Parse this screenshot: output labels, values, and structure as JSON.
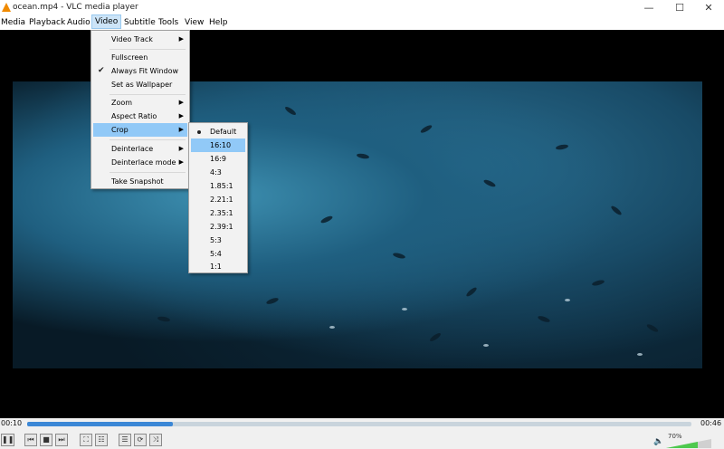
{
  "window": {
    "title": "ocean.mp4 - VLC media player"
  },
  "window_controls": {
    "minimize": "—",
    "maximize": "☐",
    "close": "✕"
  },
  "menubar": {
    "items": [
      "Media",
      "Playback",
      "Audio",
      "Video",
      "Subtitle",
      "Tools",
      "View",
      "Help"
    ],
    "open": "Video"
  },
  "video_menu": {
    "items": [
      {
        "label": "Video Track",
        "submenu": true
      },
      {
        "label": "Fullscreen"
      },
      {
        "label": "Always Fit Window",
        "checked": true
      },
      {
        "label": "Set as Wallpaper"
      },
      {
        "label": "Zoom",
        "submenu": true
      },
      {
        "label": "Aspect Ratio",
        "submenu": true
      },
      {
        "label": "Crop",
        "submenu": true,
        "highlighted": true
      },
      {
        "label": "Deinterlace",
        "submenu": true
      },
      {
        "label": "Deinterlace mode",
        "submenu": true
      },
      {
        "label": "Take Snapshot"
      }
    ]
  },
  "crop_menu": {
    "selected": "Default",
    "highlighted": "16:10",
    "items": [
      "Default",
      "16:10",
      "16:9",
      "4:3",
      "1.85:1",
      "2.21:1",
      "2.35:1",
      "2.39:1",
      "5:3",
      "5:4",
      "1:1"
    ]
  },
  "player": {
    "elapsed": "00:10",
    "duration": "00:46",
    "progress_fraction": 0.22,
    "volume_label": "70%",
    "volume_fraction": 0.7
  },
  "icons": {
    "pause": "❚❚",
    "prev": "⏮",
    "stop": "■",
    "next": "⏭",
    "fullscreen": "⛶",
    "extended": "☷",
    "playlist": "☰",
    "loop": "⟳",
    "shuffle": "⤨",
    "volume": "🔈"
  },
  "colors": {
    "accent": "#3b87d6",
    "menu_highlight": "#91c9f7",
    "volume_bar": "#4ec94e"
  }
}
